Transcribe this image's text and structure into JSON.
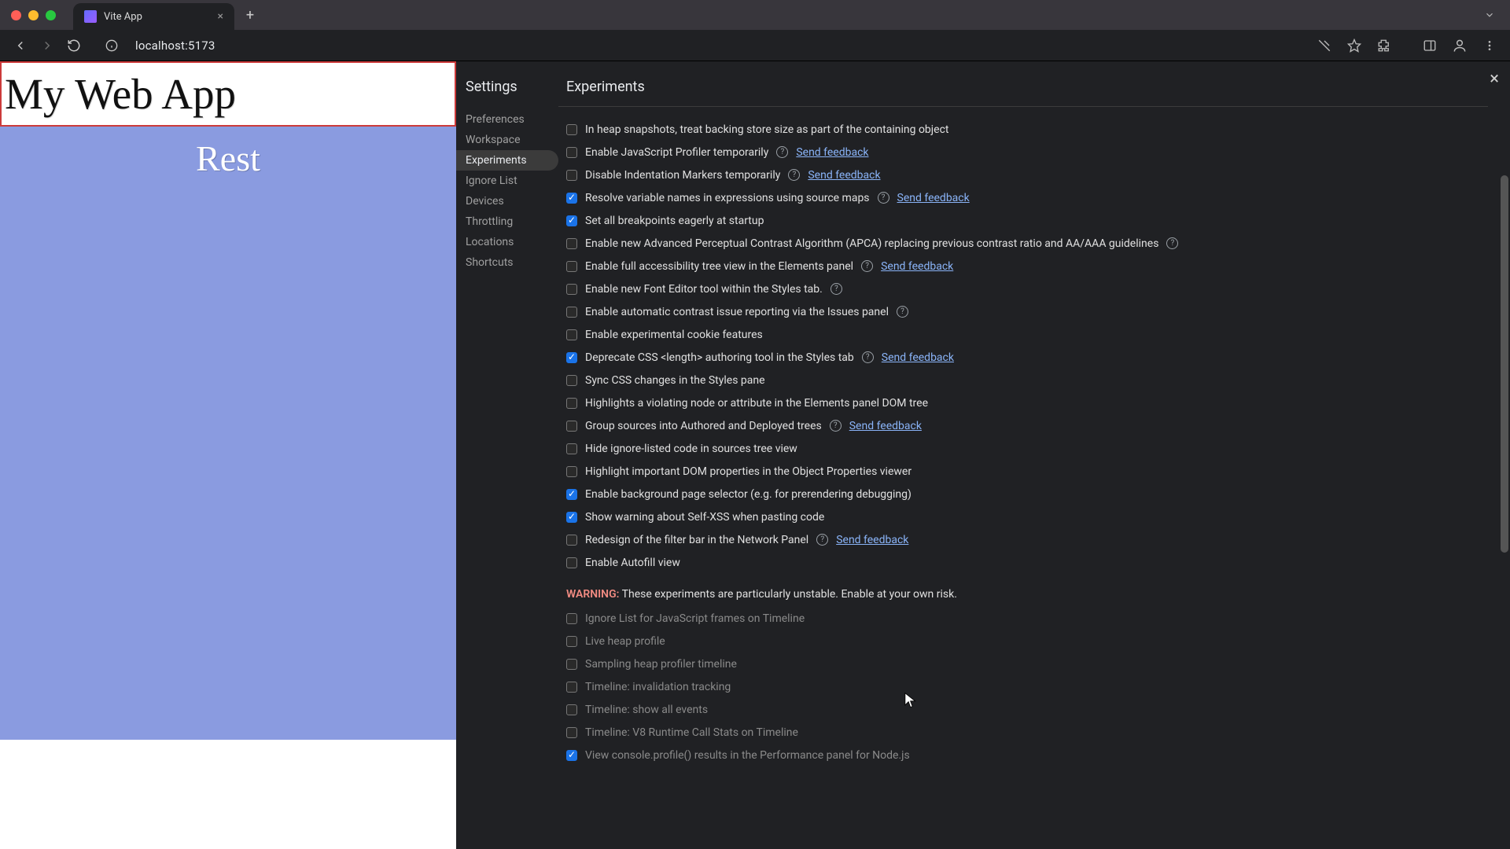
{
  "browser": {
    "tab_title": "Vite App",
    "url": "localhost:5173"
  },
  "webapp": {
    "h1": "My Web App",
    "section": "Rest"
  },
  "settings": {
    "title": "Settings",
    "panel_title": "Experiments",
    "nav": {
      "preferences": "Preferences",
      "workspace": "Workspace",
      "experiments": "Experiments",
      "ignore": "Ignore List",
      "devices": "Devices",
      "throttling": "Throttling",
      "locations": "Locations",
      "shortcuts": "Shortcuts"
    },
    "send_feedback": "Send feedback",
    "experiments": [
      {
        "label": "In heap snapshots, treat backing store size as part of the containing object",
        "checked": false,
        "help": false,
        "feedback": false
      },
      {
        "label": "Enable JavaScript Profiler temporarily",
        "checked": false,
        "help": true,
        "feedback": true
      },
      {
        "label": "Disable Indentation Markers temporarily",
        "checked": false,
        "help": true,
        "feedback": true
      },
      {
        "label": "Resolve variable names in expressions using source maps",
        "checked": true,
        "help": true,
        "feedback": true
      },
      {
        "label": "Set all breakpoints eagerly at startup",
        "checked": true,
        "help": false,
        "feedback": false
      },
      {
        "label": "Enable new Advanced Perceptual Contrast Algorithm (APCA) replacing previous contrast ratio and AA/AAA guidelines",
        "checked": false,
        "help": true,
        "feedback": false
      },
      {
        "label": "Enable full accessibility tree view in the Elements panel",
        "checked": false,
        "help": true,
        "feedback": true
      },
      {
        "label": "Enable new Font Editor tool within the Styles tab.",
        "checked": false,
        "help": true,
        "feedback": false
      },
      {
        "label": "Enable automatic contrast issue reporting via the Issues panel",
        "checked": false,
        "help": true,
        "feedback": false
      },
      {
        "label": "Enable experimental cookie features",
        "checked": false,
        "help": false,
        "feedback": false
      },
      {
        "label": "Deprecate CSS <length> authoring tool in the Styles tab",
        "checked": true,
        "help": true,
        "feedback": true
      },
      {
        "label": "Sync CSS changes in the Styles pane",
        "checked": false,
        "help": false,
        "feedback": false
      },
      {
        "label": "Highlights a violating node or attribute in the Elements panel DOM tree",
        "checked": false,
        "help": false,
        "feedback": false
      },
      {
        "label": "Group sources into Authored and Deployed trees",
        "checked": false,
        "help": true,
        "feedback": true
      },
      {
        "label": "Hide ignore-listed code in sources tree view",
        "checked": false,
        "help": false,
        "feedback": false
      },
      {
        "label": "Highlight important DOM properties in the Object Properties viewer",
        "checked": false,
        "help": false,
        "feedback": false
      },
      {
        "label": "Enable background page selector (e.g. for prerendering debugging)",
        "checked": true,
        "help": false,
        "feedback": false
      },
      {
        "label": "Show warning about Self-XSS when pasting code",
        "checked": true,
        "help": false,
        "feedback": false
      },
      {
        "label": "Redesign of the filter bar in the Network Panel",
        "checked": false,
        "help": true,
        "feedback": true
      },
      {
        "label": "Enable Autofill view",
        "checked": false,
        "help": false,
        "feedback": false
      }
    ],
    "warning": {
      "prefix": "WARNING:",
      "text": " These experiments are particularly unstable. Enable at your own risk."
    },
    "unstable": [
      {
        "label": "Ignore List for JavaScript frames on Timeline",
        "checked": false
      },
      {
        "label": "Live heap profile",
        "checked": false
      },
      {
        "label": "Sampling heap profiler timeline",
        "checked": false
      },
      {
        "label": "Timeline: invalidation tracking",
        "checked": false
      },
      {
        "label": "Timeline: show all events",
        "checked": false
      },
      {
        "label": "Timeline: V8 Runtime Call Stats on Timeline",
        "checked": false
      },
      {
        "label": "View console.profile() results in the Performance panel for Node.js",
        "checked": true
      }
    ]
  }
}
